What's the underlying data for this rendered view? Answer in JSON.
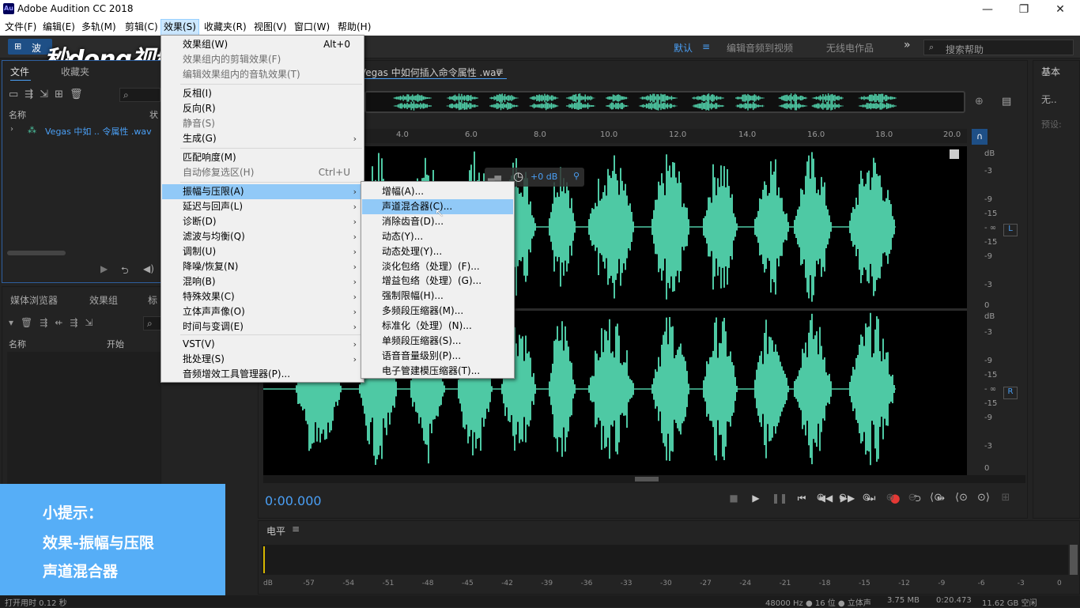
{
  "window": {
    "title": "Adobe Audition CC 2018",
    "logo": "Au",
    "controls": [
      "—",
      "❐",
      "✕"
    ]
  },
  "menubar": [
    "文件(F)",
    "编辑(E)",
    "多轨(M)",
    "剪辑(C)",
    "效果(S)",
    "收藏夹(R)",
    "视图(V)",
    "窗口(W)",
    "帮助(H)"
  ],
  "watermark": "秒dong视频",
  "toolbar": {
    "mode_tab": "波",
    "workspaces": [
      "默认",
      "编辑音频到视频",
      "无线电作品"
    ],
    "more": "»",
    "search_placeholder": "搜索帮助"
  },
  "files_panel": {
    "tabs": [
      "文件",
      "收藏夹"
    ],
    "col_name": "名称",
    "col_status": "状",
    "file": "Vegas 中如 .. 令属性 .wav"
  },
  "media_panel": {
    "tabs": [
      "媒体浏览器",
      "效果组",
      "标"
    ],
    "col_name": "名称",
    "col_start": "开始"
  },
  "editor": {
    "tab_title": "Vegas 中如何插入命令属性 .wav",
    "time_ticks": [
      "4.0",
      "6.0",
      "8.0",
      "10.0",
      "12.0",
      "14.0",
      "16.0",
      "18.0",
      "20.0"
    ],
    "hud_gain": "+0 dB",
    "db_top": [
      "dB",
      "-3",
      "-9",
      "-15",
      "- ∞",
      "-15",
      "-9",
      "-3",
      "0"
    ],
    "db_bottom": [
      "dB",
      "-3",
      "-9",
      "-15",
      "- ∞",
      "-15",
      "-9",
      "-3",
      "0"
    ],
    "channels": [
      "L",
      "R"
    ],
    "timecode": "0:00.000"
  },
  "right_panel": {
    "title": "基本",
    "value": "无..",
    "preset": "预设:"
  },
  "levels": {
    "title": "电平",
    "scale": [
      "dB",
      "-57",
      "-54",
      "-51",
      "-48",
      "-45",
      "-42",
      "-39",
      "-36",
      "-33",
      "-30",
      "-27",
      "-24",
      "-21",
      "-18",
      "-15",
      "-12",
      "-9",
      "-6",
      "-3",
      "0"
    ]
  },
  "effects_menu": {
    "items": [
      {
        "label": "效果组(W)",
        "shortcut": "Alt+0",
        "disabled": false
      },
      {
        "label": "效果组内的剪辑效果(F)",
        "disabled": true
      },
      {
        "label": "编辑效果组内的音轨效果(T)",
        "disabled": true
      },
      {
        "label": "反相(I)"
      },
      {
        "label": "反向(R)"
      },
      {
        "label": "静音(S)",
        "disabled": true
      },
      {
        "label": "生成(G)",
        "submenu": true
      },
      {
        "label": "匹配响度(M)"
      },
      {
        "label": "自动修复选区(H)",
        "shortcut": "Ctrl+U",
        "disabled": true
      },
      {
        "label": "振幅与压限(A)",
        "submenu": true,
        "highlighted": true
      },
      {
        "label": "延迟与回声(L)",
        "submenu": true
      },
      {
        "label": "诊断(D)",
        "submenu": true
      },
      {
        "label": "滤波与均衡(Q)",
        "submenu": true
      },
      {
        "label": "调制(U)",
        "submenu": true
      },
      {
        "label": "降噪/恢复(N)",
        "submenu": true
      },
      {
        "label": "混响(B)",
        "submenu": true
      },
      {
        "label": "特殊效果(C)",
        "submenu": true
      },
      {
        "label": "立体声声像(O)",
        "submenu": true
      },
      {
        "label": "时间与变调(E)",
        "submenu": true
      },
      {
        "label": "VST(V)",
        "submenu": true
      },
      {
        "label": "批处理(S)",
        "submenu": true
      },
      {
        "label": "音频增效工具管理器(P)..."
      }
    ]
  },
  "amplitude_submenu": [
    "增幅(A)...",
    "声道混合器(C)...",
    "消除齿音(D)...",
    "动态(Y)...",
    "动态处理(Y)...",
    "淡化包络（处理）(F)...",
    "增益包络（处理）(G)...",
    "强制限幅(H)...",
    "多频段压缩器(M)...",
    "标准化（处理）(N)...",
    "单频段压缩器(S)...",
    "语音音量级别(P)...",
    "电子管建模压缩器(T)..."
  ],
  "amplitude_submenu_highlight": 1,
  "hint": {
    "title": "小提示：",
    "line1": "效果-振幅与压限",
    "line2": "声道混合器"
  },
  "status": {
    "left": "打开用时 0.12 秒",
    "format": "48000 Hz ● 16 位 ● 立体声",
    "size": "3.75 MB",
    "duration": "0:20.473",
    "free": "11.62 GB 空闲"
  },
  "colors": {
    "waveform": "#4ec9a4",
    "accent": "#4a9ff5",
    "highlight": "#91c9f7",
    "hint_bg": "#56aef7"
  }
}
